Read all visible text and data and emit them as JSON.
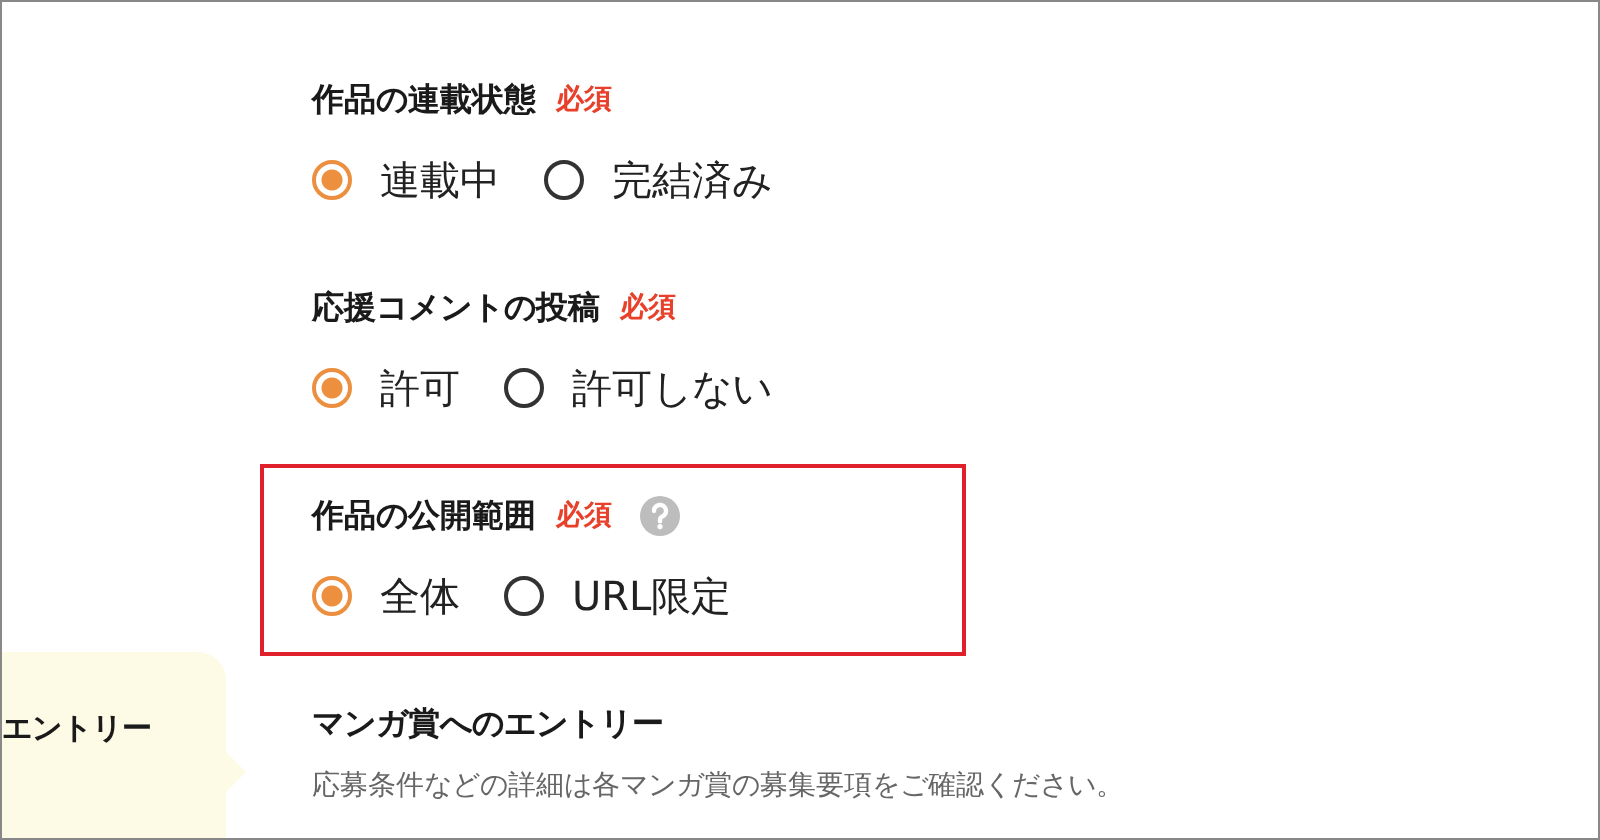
{
  "sections": [
    {
      "title": "作品の連載状態",
      "required": "必須",
      "help": false,
      "highlighted": false,
      "options": [
        {
          "label": "連載中",
          "selected": true
        },
        {
          "label": "完結済み",
          "selected": false
        }
      ]
    },
    {
      "title": "応援コメントの投稿",
      "required": "必須",
      "help": false,
      "highlighted": false,
      "options": [
        {
          "label": "許可",
          "selected": true
        },
        {
          "label": "許可しない",
          "selected": false
        }
      ]
    },
    {
      "title": "作品の公開範囲",
      "required": "必須",
      "help": true,
      "highlighted": true,
      "options": [
        {
          "label": "全体",
          "selected": true
        },
        {
          "label": "URL限定",
          "selected": false
        }
      ]
    },
    {
      "title": "マンガ賞へのエントリー",
      "help": false,
      "highlighted": false,
      "note": "応募条件などの詳細は各マンガ賞の募集要項をご確認ください。"
    }
  ],
  "tooltip": {
    "title": "エントリー"
  }
}
